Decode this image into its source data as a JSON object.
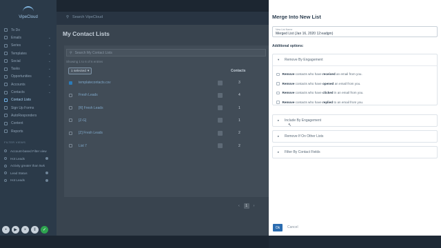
{
  "app": {
    "logo_text": "VipeCloud",
    "search_placeholder": "Search VipeCloud"
  },
  "sidebar": {
    "items": [
      {
        "label": "To Do",
        "chevron": false
      },
      {
        "label": "Emails",
        "chevron": true
      },
      {
        "label": "Series",
        "chevron": true
      },
      {
        "label": "Templates",
        "chevron": true
      },
      {
        "label": "Social",
        "chevron": true
      },
      {
        "label": "Tasks",
        "chevron": true
      },
      {
        "label": "Opportunities",
        "chevron": true
      },
      {
        "label": "Accounts",
        "chevron": true
      },
      {
        "label": "Contacts",
        "chevron": true
      },
      {
        "label": "Contact Lists",
        "chevron": false,
        "active": true
      },
      {
        "label": "Sign Up Forms",
        "chevron": false
      },
      {
        "label": "AutoResponders",
        "chevron": false
      },
      {
        "label": "Content",
        "chevron": false
      },
      {
        "label": "Reports",
        "chevron": false
      }
    ],
    "filters_heading": "FILTER VIEWS",
    "filters": [
      {
        "label": "Account-based Filter view",
        "dot": false
      },
      {
        "label": "Hot Leads",
        "dot": true
      },
      {
        "label": "Activity greater than 5wk",
        "dot": false
      },
      {
        "label": "Lead Status",
        "dot": true
      },
      {
        "label": "Hot Leads",
        "dot": true
      }
    ]
  },
  "main": {
    "title": "My Contact Lists",
    "search_placeholder": "Search My Contact Lists",
    "showing": "Showing 1 to 6 of 6 entries",
    "selected": "1 selected",
    "col_contacts": "Contacts",
    "rows": [
      {
        "name": "templatecontacts.csv",
        "count": "3",
        "checked": true
      },
      {
        "name": "Fresh Leads",
        "count": "4",
        "checked": false
      },
      {
        "name": "[R] Fresh Leads",
        "count": "1",
        "checked": false
      },
      {
        "name": "[Z-G]",
        "count": "1",
        "checked": false
      },
      {
        "name": "[Z] Fresh Leads",
        "count": "2",
        "checked": false
      },
      {
        "name": "List 7",
        "count": "2",
        "checked": false
      }
    ],
    "page": "1"
  },
  "panel": {
    "title": "Merge Into New List",
    "name_label": "New List Name",
    "name_value": "Merged List (Jan 16, 2020 12:eadgm)",
    "additional_options": "Additional options:",
    "sections": [
      {
        "label": "Remove By Engagement",
        "expanded": true
      },
      {
        "label": "Include By Engagement",
        "expanded": false
      },
      {
        "label": "Remove If On Other Lists",
        "expanded": false
      },
      {
        "label": "Filter By Contact Fields",
        "expanded": false
      }
    ],
    "engagement_options": [
      {
        "pre": "Remove",
        "mid": "contacts who have",
        "bold": "received",
        "post": "an email from you."
      },
      {
        "pre": "Remove",
        "mid": "contacts who have",
        "bold": "opened",
        "post": "an email from you."
      },
      {
        "pre": "Remove",
        "mid": "contacts who have",
        "bold": "clicked",
        "post": "in an email from you."
      },
      {
        "pre": "Remove",
        "mid": "contacts who have",
        "bold": "replied",
        "post": "to an email from you."
      }
    ],
    "ok_label": "Ok",
    "cancel_label": "Cancel"
  }
}
